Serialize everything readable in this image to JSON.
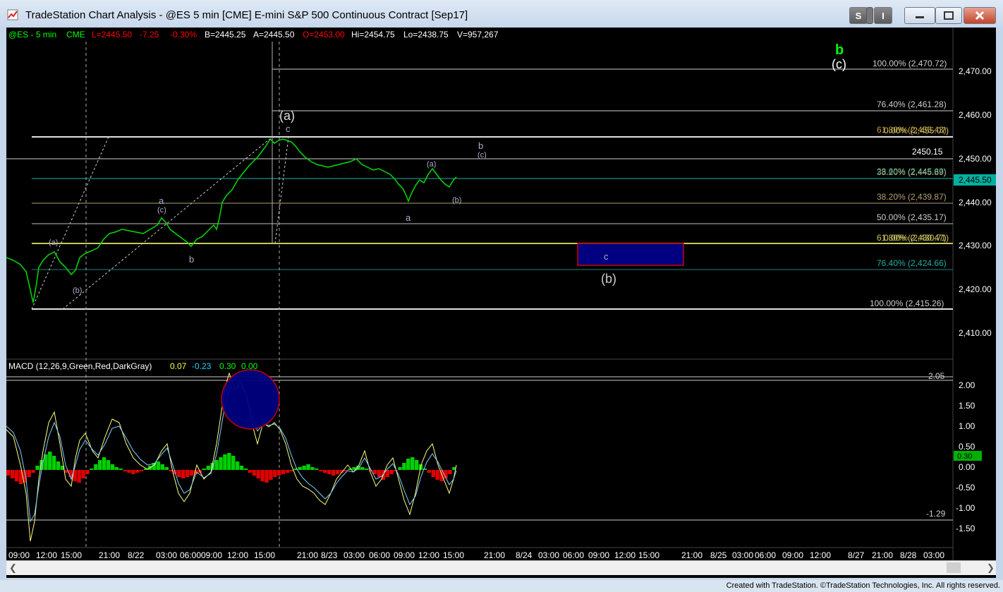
{
  "window": {
    "title": "TradeStation Chart Analysis - @ES 5 min [CME] E-mini S&P 500 Continuous Contract [Sep17]",
    "btn_s": "S",
    "btn_i": "I",
    "status_text": "Created with TradeStation. ©TradeStation Technologies, Inc. All rights reserved."
  },
  "header": {
    "symbol": "@ES - 5 min",
    "exchange": "CME",
    "last": "L=2445.50",
    "change": "-7.25",
    "pct": "-0.30%",
    "bid": "B=2445.25",
    "ask": "A=2445.50",
    "open": "O=2453.00",
    "high": "Hi=2454.75",
    "low": "Lo=2438.75",
    "volume": "V=957,267"
  },
  "macd": {
    "label": "MACD (12,26,9,Green,Red,DarkGray)",
    "v1": "0.07",
    "v2": "-0.23",
    "v3": "0.30",
    "v4": "0.00",
    "tag_top": "2.05",
    "tag_bottom": "-1.29",
    "tag_current": "0.30"
  },
  "price_axis": {
    "ticks": [
      "2,470.00",
      "2,460.00",
      "2,450.00",
      "2,440.00",
      "2,430.00",
      "2,420.00",
      "2,410.00"
    ],
    "last_tag": "2,445.50"
  },
  "macd_axis": {
    "ticks": [
      "2.00",
      "1.50",
      "1.00",
      "0.50",
      "0.00",
      "-0.50",
      "-1.00",
      "-1.50"
    ]
  },
  "time_axis": {
    "labels": [
      "09:00",
      "12:00",
      "15:00",
      "21:00",
      "8/22",
      "03:00",
      "06:00",
      "09:00",
      "12:00",
      "15:00",
      "21:00",
      "8/23",
      "03:00",
      "06:00",
      "09:00",
      "12:00",
      "15:00",
      "21:00",
      "8/24",
      "03:00",
      "06:00",
      "09:00",
      "12:00",
      "15:00",
      "21:00",
      "8/25",
      "03:00",
      "06:00",
      "09:00",
      "12:00",
      "8/27",
      "21:00",
      "8/28",
      "03:00"
    ]
  },
  "fib_labels": {
    "upper": [
      "100.00% (2,470.72)",
      "76.40% (2,461.28)",
      "61.80% (2,455.43)",
      "0.00% (2,455.07)",
      "23.60% (2,445.63)",
      "38.20% (2,445.89)",
      "38.20% (2,439.87)",
      "50.00% (2,435.17)",
      "61.80% (2,430.47)",
      "0.00% (2,430.71)",
      "76.40% (2,424.66)",
      "100.00% (2,415.26)"
    ],
    "level_2450": "2450.15"
  },
  "wave_labels": {
    "b_green": "b",
    "c_paren_right": "(c)",
    "a_paren_large": "(a)",
    "c_top": "c",
    "b_right": "b",
    "c_paren_small": "(c)",
    "a_paren_small": "(a)",
    "b_paren_small": "(b)",
    "a_low": "a",
    "a_mid": "a",
    "c_paren_mid": "(c)",
    "b_mid": "b",
    "a_paren_left": "(a)",
    "b_paren_left": "(b)",
    "c_box": "c",
    "b_paren_large": "(b)"
  },
  "colors": {
    "green": "#00ff00",
    "red": "#ff0000",
    "macd_green": "#00d000",
    "macd_red": "#e00000",
    "target_box": "#000080",
    "target_border": "#cc0000"
  }
}
